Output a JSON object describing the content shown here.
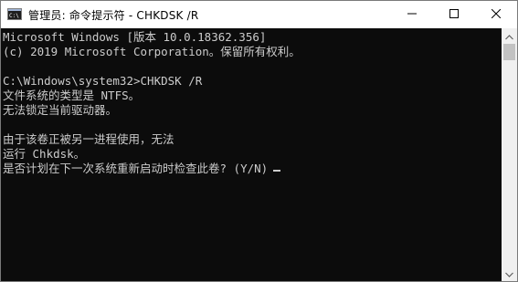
{
  "window": {
    "title": "管理员: 命令提示符 - CHKDSK  /R",
    "icons": {
      "app": "cmd-icon",
      "minimize": "minimize-icon",
      "maximize": "maximize-icon",
      "close": "close-icon"
    }
  },
  "console": {
    "lines": [
      "Microsoft Windows [版本 10.0.18362.356]",
      "(c) 2019 Microsoft Corporation。保留所有权利。",
      "",
      "C:\\Windows\\system32>CHKDSK /R",
      "文件系统的类型是 NTFS。",
      "无法锁定当前驱动器。",
      "",
      "由于该卷正被另一进程使用，无法",
      "运行 Chkdsk。",
      "是否计划在下一次系统重新启动时检查此卷? (Y/N)"
    ]
  },
  "scrollbar": {
    "up": "scroll-up-arrow-icon",
    "down": "scroll-down-arrow-icon"
  }
}
